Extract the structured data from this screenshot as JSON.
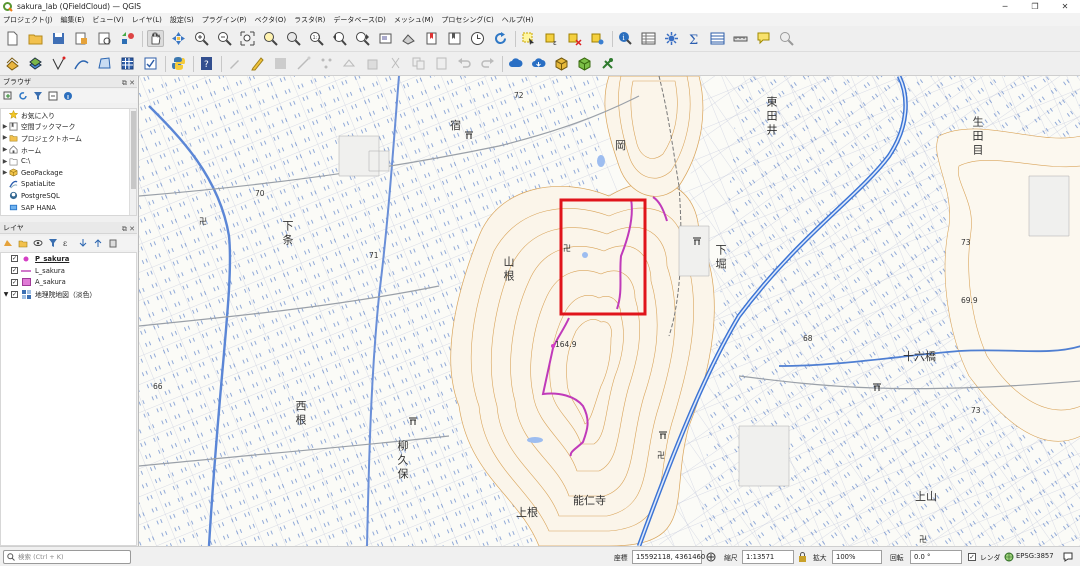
{
  "window": {
    "title": "sakura_lab (QFieldCloud) — QGIS",
    "controls": [
      "─",
      "❐",
      "✕"
    ]
  },
  "menubar": {
    "items": [
      "プロジェクト(J)",
      "編集(E)",
      "ビュー(V)",
      "レイヤ(L)",
      "設定(S)",
      "プラグイン(P)",
      "ベクタ(O)",
      "ラスタ(R)",
      "データベース(D)",
      "メッシュ(M)",
      "プロセシング(C)",
      "ヘルプ(H)"
    ]
  },
  "browser_panel": {
    "title": "ブラウザ",
    "items": [
      {
        "label": "お気に入り",
        "icon": "star-icon",
        "expandable": false
      },
      {
        "label": "空間ブックマーク",
        "icon": "bookmark-icon",
        "expandable": true
      },
      {
        "label": "プロジェクトホーム",
        "icon": "project-home-icon",
        "expandable": true
      },
      {
        "label": "ホーム",
        "icon": "home-icon",
        "expandable": true
      },
      {
        "label": "C:\\",
        "icon": "folder-icon",
        "expandable": true
      },
      {
        "label": "GeoPackage",
        "icon": "geopackage-icon",
        "expandable": true
      },
      {
        "label": "SpatiaLite",
        "icon": "spatialite-icon",
        "expandable": false
      },
      {
        "label": "PostgreSQL",
        "icon": "postgresql-icon",
        "expandable": false
      },
      {
        "label": "SAP HANA",
        "icon": "sap-hana-icon",
        "expandable": false
      }
    ]
  },
  "layers_panel": {
    "title": "レイヤ",
    "layers": [
      {
        "name": "P_sakura",
        "type": "point",
        "checked": true,
        "selected": true,
        "color": "#d53fc5"
      },
      {
        "name": "L_sakura",
        "type": "line",
        "checked": true,
        "selected": false,
        "color": "#c04ab8"
      },
      {
        "name": "A_sakura",
        "type": "polygon",
        "checked": true,
        "selected": false,
        "color": "#e07ad6"
      },
      {
        "name": "地理院地図（淡色）",
        "type": "raster",
        "checked": true,
        "selected": false,
        "color": "#3a6fb3"
      }
    ]
  },
  "map": {
    "place_labels": [
      "東",
      "田",
      "井",
      "生",
      "田",
      "目",
      "宿",
      "岡",
      "下",
      "条",
      "山",
      "根",
      "下",
      "堀",
      "十六橋",
      "西",
      "根",
      "柳",
      "久",
      "保",
      "能",
      "仁",
      "寺",
      "上",
      "根",
      "上",
      "山"
    ],
    "elevations": [
      "72",
      "70",
      "71",
      "73",
      "69.9",
      "68",
      "66",
      "164.9",
      "73"
    ],
    "highlight_color": "#e0141b",
    "route_color": "#c03aba"
  },
  "statusbar": {
    "locator_placeholder": "検索 (Ctrl + K)",
    "coordinate_label": "座標",
    "coordinate": "15592118, 4361460",
    "scale_label": "縮尺",
    "scale": "1:13571",
    "magnifier_label": "拡大",
    "magnifier": "100%",
    "rotation_label": "回転",
    "rotation": "0.0 °",
    "render_label": "レンダ",
    "crs": "EPSG:3857"
  }
}
